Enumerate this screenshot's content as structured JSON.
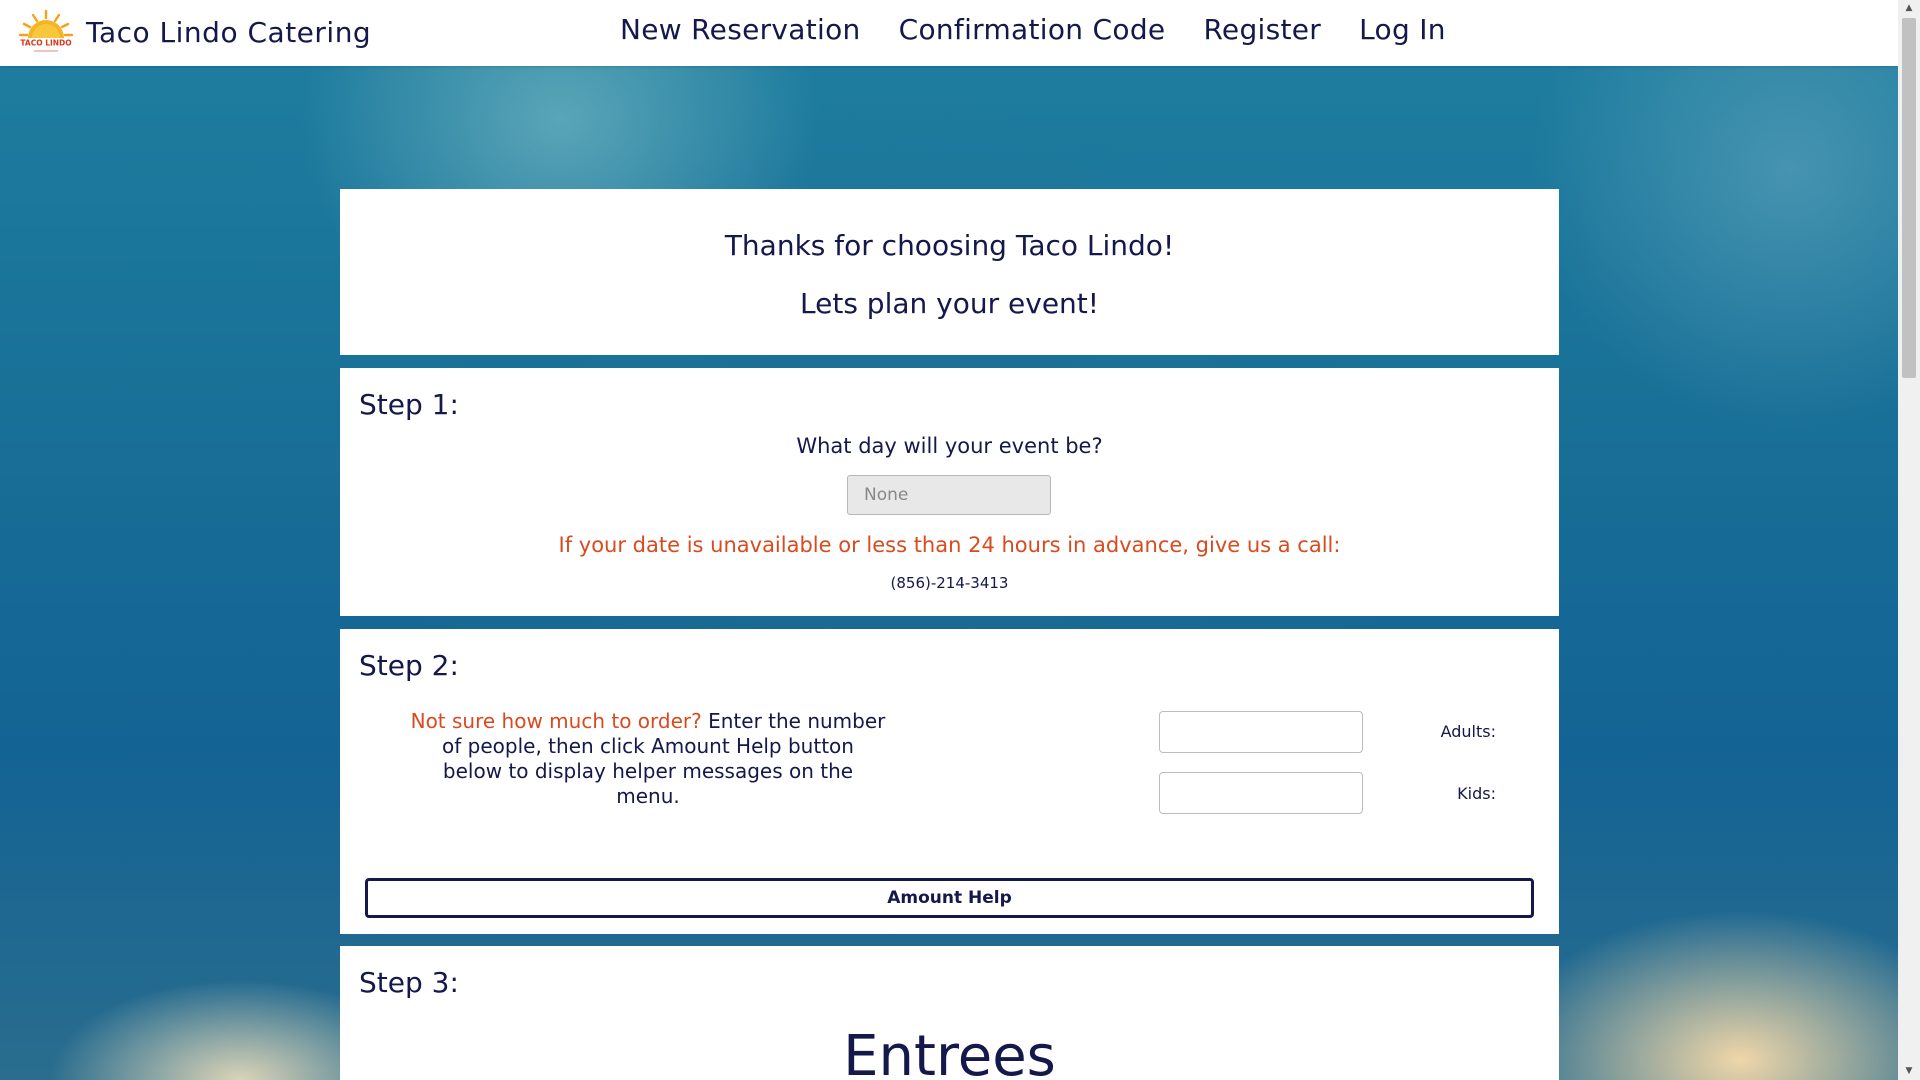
{
  "brand": {
    "name": "Taco Lindo Catering",
    "logo_text": "TACO LINDO"
  },
  "nav": {
    "items": [
      {
        "label": "New Reservation"
      },
      {
        "label": "Confirmation Code"
      },
      {
        "label": "Register"
      },
      {
        "label": "Log In"
      }
    ]
  },
  "welcome": {
    "line1": "Thanks for choosing Taco Lindo!",
    "line2": "Lets plan your event!"
  },
  "step1": {
    "title": "Step 1:",
    "question": "What day will your event be?",
    "date_placeholder": "None",
    "warning": "If your date is unavailable or less than 24 hours in advance, give us a call:",
    "phone": "(856)-214-3413"
  },
  "step2": {
    "title": "Step 2:",
    "help_accent": "Not sure how much to order?",
    "help_rest": " Enter the number of people, then click Amount Help button below to display helper messages on the menu.",
    "adults_label": "Adults:",
    "adults_value": "",
    "kids_label": "Kids:",
    "kids_value": "",
    "amount_help_label": "Amount Help"
  },
  "step3": {
    "title": "Step 3:",
    "heading": "Entrees"
  },
  "colors": {
    "navy": "#14184a",
    "accent_orange": "#d94a1e",
    "background_teal": "#186f97"
  }
}
